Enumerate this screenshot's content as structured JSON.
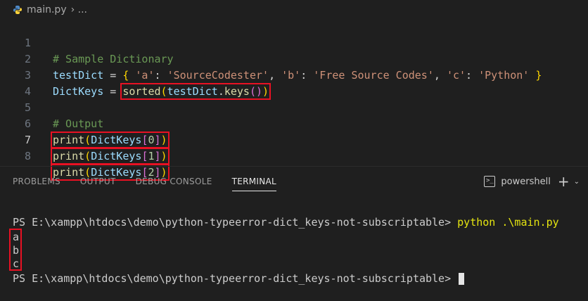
{
  "breadcrumb": {
    "file": "main.py",
    "separator": "› ...",
    "icon": "python-file-icon"
  },
  "editor": {
    "line_numbers": [
      "1",
      "2",
      "3",
      "4",
      "5",
      "6",
      "7",
      "8"
    ],
    "line1": {
      "comment": "# Sample Dictionary"
    },
    "line2": {
      "var": "testDict",
      "eq": " = ",
      "open": "{",
      "k1": "'a'",
      "c1": ": ",
      "v1": "'SourceCodester'",
      "s1": ", ",
      "k2": "'b'",
      "c2": ": ",
      "v2": "'Free Source Codes'",
      "s2": ", ",
      "k3": "'c'",
      "c3": ": ",
      "v3": "'Python'",
      "close": " }"
    },
    "line3": {
      "var": "DictKeys",
      "eq": " = ",
      "fn": "sorted",
      "p1": "(",
      "obj": "testDict",
      "dot": ".",
      "method": "keys",
      "p2": "()",
      "p3": ")"
    },
    "line5": {
      "comment": "# Output"
    },
    "line6": {
      "fn": "print",
      "p1": "(",
      "var": "DictKeys",
      "b1": "[",
      "idx": "0",
      "b2": "]",
      "p2": ")"
    },
    "line7": {
      "fn": "print",
      "p1": "(",
      "var": "DictKeys",
      "b1": "[",
      "idx": "1",
      "b2": "]",
      "p2": ")"
    },
    "line8": {
      "fn": "print",
      "p1": "(",
      "var": "DictKeys",
      "b1": "[",
      "idx": "2",
      "b2": "]",
      "p2": ")"
    }
  },
  "panel": {
    "tabs": [
      "PROBLEMS",
      "OUTPUT",
      "DEBUG CONSOLE",
      "TERMINAL"
    ],
    "active_tab": "TERMINAL",
    "terminal_name": "powershell",
    "add": "+",
    "dropdown": "⌄"
  },
  "terminal": {
    "prompt1": "PS E:\\xampp\\htdocs\\demo\\python-typeerror-dict_keys-not-subscriptable> ",
    "command": "python .\\main.py",
    "outputs": [
      "a",
      "b",
      "c"
    ],
    "prompt2": "PS E:\\xampp\\htdocs\\demo\\python-typeerror-dict_keys-not-subscriptable> "
  },
  "colors": {
    "highlight_box": "#e81123",
    "background": "#1f1f1f"
  }
}
